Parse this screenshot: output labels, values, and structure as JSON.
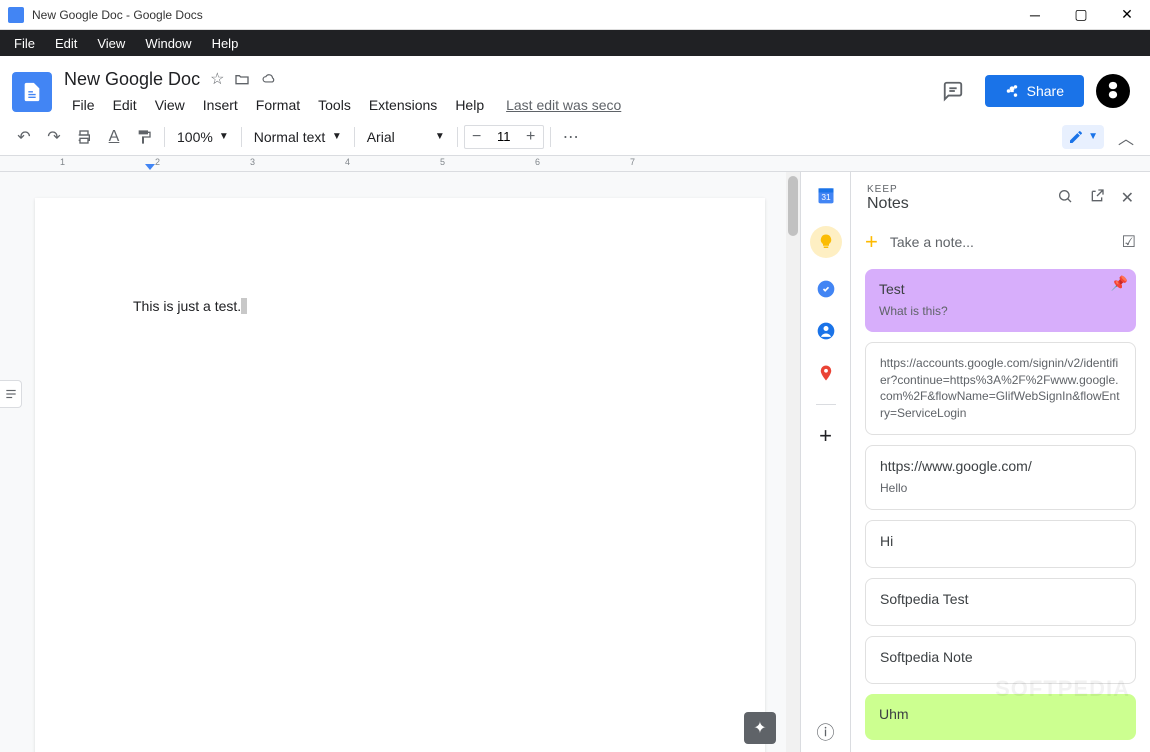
{
  "window": {
    "title": "New Google Doc - Google Docs"
  },
  "menubar": [
    "File",
    "Edit",
    "View",
    "Window",
    "Help"
  ],
  "doc": {
    "title": "New Google Doc",
    "menus": [
      "File",
      "Edit",
      "View",
      "Insert",
      "Format",
      "Tools",
      "Extensions",
      "Help"
    ],
    "last_edit": "Last edit was seco",
    "share_label": "Share",
    "zoom": "100%",
    "style": "Normal text",
    "font": "Arial",
    "font_size": "11",
    "body_text": "This is just a test."
  },
  "ruler_numbers": [
    "1",
    "2",
    "3",
    "4",
    "5",
    "6",
    "7"
  ],
  "keep": {
    "eyebrow": "KEEP",
    "title": "Notes",
    "take_note": "Take a note...",
    "notes": [
      {
        "title": "Test",
        "body": "What is this?",
        "color": "purple",
        "pinned": true
      },
      {
        "title": "",
        "body": "https://accounts.google.com/signin/v2/identifier?continue=https%3A%2F%2Fwww.google.com%2F&flowName=GlifWebSignIn&flowEntry=ServiceLogin",
        "color": ""
      },
      {
        "title": "https://www.google.com/",
        "body": "Hello",
        "color": ""
      },
      {
        "title": "Hi",
        "body": "",
        "color": ""
      },
      {
        "title": "Softpedia Test",
        "body": "",
        "color": ""
      },
      {
        "title": "Softpedia Note",
        "body": "",
        "color": ""
      },
      {
        "title": "Uhm",
        "body": "",
        "color": "green"
      }
    ]
  },
  "watermark": "SOFTPEDIA"
}
